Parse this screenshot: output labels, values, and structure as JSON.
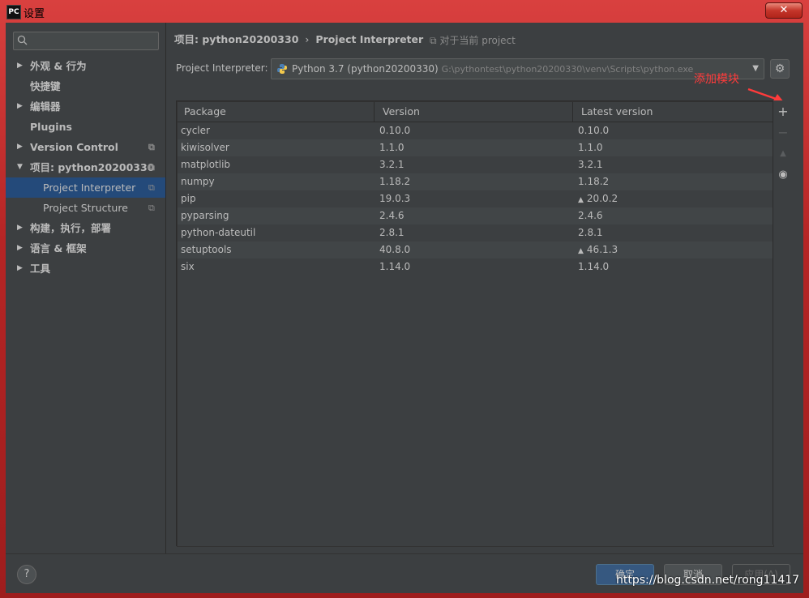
{
  "window": {
    "title": "设置",
    "logo": "PC",
    "close_glyph": "✕"
  },
  "search": {
    "placeholder": ""
  },
  "sidebar": {
    "items": [
      {
        "label": "外观 & 行为",
        "arrow": "▶"
      },
      {
        "label": "快捷键"
      },
      {
        "label": "编辑器",
        "arrow": "▶"
      },
      {
        "label": "Plugins"
      },
      {
        "label": "Version Control",
        "arrow": "▶"
      },
      {
        "label": "项目: python20200330",
        "arrow": "▼"
      },
      {
        "label": "Project Interpreter"
      },
      {
        "label": "Project Structure"
      },
      {
        "label": "构建，执行，部署",
        "arrow": "▶"
      },
      {
        "label": "语言 & 框架",
        "arrow": "▶"
      },
      {
        "label": "工具",
        "arrow": "▶"
      }
    ]
  },
  "header": {
    "crumb_project": "项目: python20200330",
    "crumb_sep": "›",
    "crumb_page": "Project Interpreter",
    "for_current_project": "对于当前 project"
  },
  "interpreter": {
    "label": "Project Interpreter:",
    "name": "Python 3.7 (python20200330)",
    "path": "G:\\pythontest\\python20200330\\venv\\Scripts\\python.exe"
  },
  "annotation": {
    "text": "添加模块",
    "color": "#ff3b3b"
  },
  "table": {
    "columns": [
      "Package",
      "Version",
      "Latest version"
    ],
    "rows": [
      {
        "package": "cycler",
        "version": "0.10.0",
        "latest": "0.10.0",
        "upgrade": false
      },
      {
        "package": "kiwisolver",
        "version": "1.1.0",
        "latest": "1.1.0",
        "upgrade": false
      },
      {
        "package": "matplotlib",
        "version": "3.2.1",
        "latest": "3.2.1",
        "upgrade": false
      },
      {
        "package": "numpy",
        "version": "1.18.2",
        "latest": "1.18.2",
        "upgrade": false
      },
      {
        "package": "pip",
        "version": "19.0.3",
        "latest": "20.0.2",
        "upgrade": true
      },
      {
        "package": "pyparsing",
        "version": "2.4.6",
        "latest": "2.4.6",
        "upgrade": false
      },
      {
        "package": "python-dateutil",
        "version": "2.8.1",
        "latest": "2.8.1",
        "upgrade": false
      },
      {
        "package": "setuptools",
        "version": "40.8.0",
        "latest": "46.1.3",
        "upgrade": true
      },
      {
        "package": "six",
        "version": "1.14.0",
        "latest": "1.14.0",
        "upgrade": false
      }
    ]
  },
  "toolbar": {
    "add": "+",
    "remove": "−",
    "upgrade": "▲",
    "show_early": "◉"
  },
  "footer": {
    "help": "?",
    "ok": "确定",
    "cancel": "取消",
    "apply": "应用(A)"
  },
  "watermark": "https://blog.csdn.net/rong11417",
  "colors": {
    "accent": "#2f65ca",
    "background": "#3c3f41",
    "titlebar": "#c62a2a"
  }
}
